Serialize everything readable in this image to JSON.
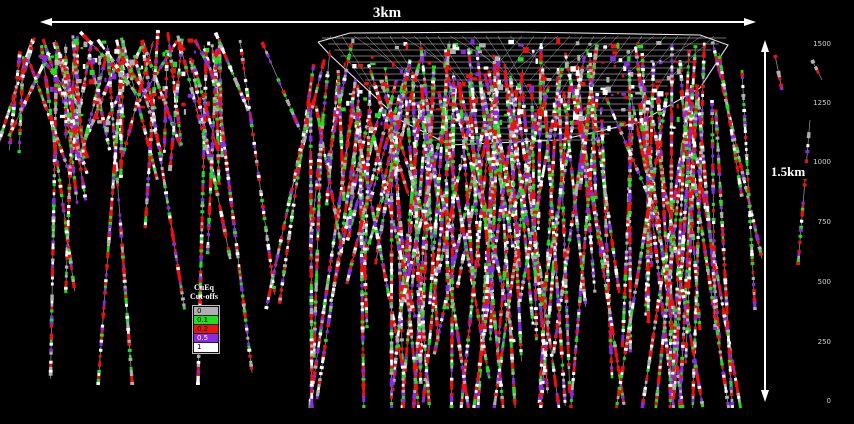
{
  "scale": {
    "horizontal_label": "3km",
    "vertical_label": "1.5km"
  },
  "axis": {
    "ticks": [
      "1500",
      "1250",
      "1000",
      "750",
      "500",
      "250",
      "0"
    ]
  },
  "legend": {
    "title_line1": "CuEq",
    "title_line2": "Cut-offs",
    "items": [
      {
        "label": "0",
        "color": "#b0b0b0"
      },
      {
        "label": "0.1",
        "color": "#22dd22"
      },
      {
        "label": "0.2",
        "color": "#ee1111"
      },
      {
        "label": "0.5",
        "color": "#8a2be2"
      },
      {
        "label": "1",
        "color": "#ffffff"
      }
    ]
  }
}
